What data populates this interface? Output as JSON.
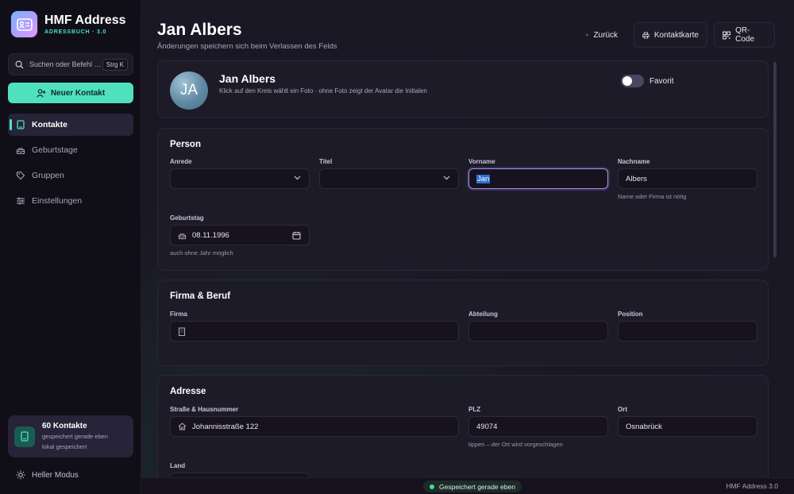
{
  "app": {
    "title": "HMF Address",
    "subtitle": "ADRESSBUCH · 3.0"
  },
  "sidebar": {
    "search_placeholder": "Suchen oder Befehl …",
    "search_shortcut": "Strg K",
    "new_contact_label": "Neuer Kontakt",
    "nav": [
      {
        "label": "Kontakte",
        "icon": "book-icon",
        "active": true
      },
      {
        "label": "Geburtstage",
        "icon": "cake-icon",
        "active": false
      },
      {
        "label": "Gruppen",
        "icon": "tag-icon",
        "active": false
      },
      {
        "label": "Einstellungen",
        "icon": "sliders-icon",
        "active": false
      }
    ],
    "stats": {
      "count": "60 Kontakte",
      "line1": "gespeichert gerade eben",
      "line2": "lokal gespeichert"
    },
    "theme_toggle": "Heller Modus"
  },
  "header": {
    "title": "Jan Albers",
    "subtitle": "Änderungen speichern sich beim Verlassen des Felds",
    "back": "Zurück",
    "contact_card": "Kontaktkarte",
    "qr_code": "QR-Code"
  },
  "profile": {
    "initials": "JA",
    "name": "Jan Albers",
    "hint": "Klick auf den Kreis wählt ein Foto · ohne Foto zeigt der Avatar die Initialen",
    "favorite_label": "Favorit",
    "favorite": false
  },
  "person": {
    "title": "Person",
    "anrede_label": "Anrede",
    "anrede_value": "",
    "titel_label": "Titel",
    "titel_value": "",
    "vorname_label": "Vorname",
    "vorname_value": "Jan",
    "nachname_label": "Nachname",
    "nachname_value": "Albers",
    "nachname_hint": "Name oder Firma ist nötig",
    "geburtstag_label": "Geburtstag",
    "geburtstag_value": "08.11.1996",
    "geburtstag_hint": "auch ohne Jahr möglich"
  },
  "firma": {
    "title": "Firma & Beruf",
    "firma_label": "Firma",
    "firma_value": "",
    "abteilung_label": "Abteilung",
    "abteilung_value": "",
    "position_label": "Position",
    "position_value": ""
  },
  "adresse": {
    "title": "Adresse",
    "strasse_label": "Straße & Hausnummer",
    "strasse_value": "Johannisstraße 122",
    "plz_label": "PLZ",
    "plz_value": "49074",
    "plz_hint": "tippen – der Ort wird vorgeschlagen",
    "ort_label": "Ort",
    "ort_value": "Osnabrück",
    "land_label": "Land"
  },
  "statusbar": {
    "saved": "Gespeichert gerade eben",
    "version": "HMF Address 3.0"
  },
  "colors": {
    "accent": "#4fe0bf",
    "focus": "#a98ef5",
    "sidebar_bg": "#100e17",
    "card_bg": "#1e1b29",
    "saved_dot": "#3ee08a"
  }
}
